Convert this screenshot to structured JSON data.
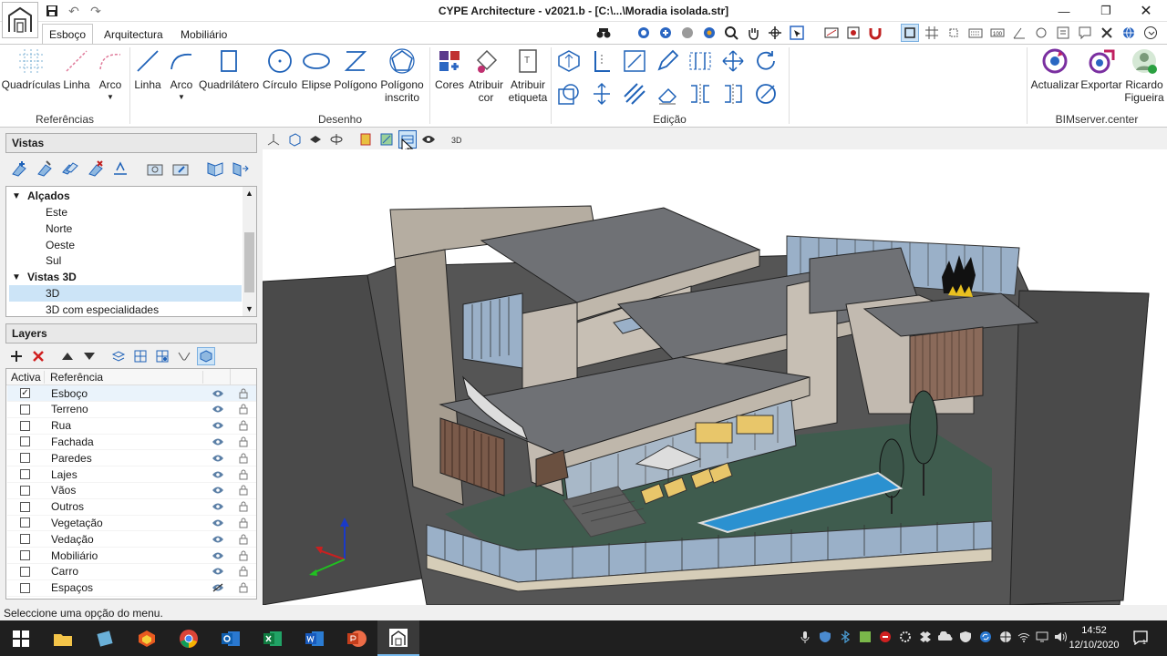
{
  "window": {
    "title": "CYPE Architecture - v2021.b - [C:\\...\\Moradia isolada.str]"
  },
  "tabs": [
    "Esboço",
    "Arquitectura",
    "Mobiliário"
  ],
  "ribbon": {
    "referencias": {
      "label": "Referências",
      "buttons": [
        "Quadrículas",
        "Linha",
        "Arco"
      ]
    },
    "desenho": {
      "label": "Desenho",
      "buttons": [
        "Linha",
        "Arco",
        "Quadrilátero",
        "Círculo",
        "Elipse",
        "Polígono",
        "Polígono\ninscrito",
        "Cores",
        "Atribuir\ncor",
        "Atribuir\netiqueta"
      ]
    },
    "edicao": {
      "label": "Edição"
    },
    "bimserver": {
      "label": "BIMserver.center",
      "buttons": [
        "Actualizar",
        "Exportar",
        "Ricardo\nFigueira"
      ]
    }
  },
  "vistas": {
    "title": "Vistas",
    "tree": [
      {
        "label": "Alçados",
        "type": "group"
      },
      {
        "label": "Este",
        "type": "item"
      },
      {
        "label": "Norte",
        "type": "item"
      },
      {
        "label": "Oeste",
        "type": "item"
      },
      {
        "label": "Sul",
        "type": "item"
      },
      {
        "label": "Vistas 3D",
        "type": "group"
      },
      {
        "label": "3D",
        "type": "item",
        "selected": true
      },
      {
        "label": "3D com especialidades",
        "type": "item"
      }
    ]
  },
  "layers": {
    "title": "Layers",
    "col_active": "Activa",
    "col_ref": "Referência",
    "rows": [
      {
        "name": "Esboço",
        "active": true,
        "visible": true
      },
      {
        "name": "Terreno",
        "active": false,
        "visible": true
      },
      {
        "name": "Rua",
        "active": false,
        "visible": true
      },
      {
        "name": "Fachada",
        "active": false,
        "visible": true
      },
      {
        "name": "Paredes",
        "active": false,
        "visible": true
      },
      {
        "name": "Lajes",
        "active": false,
        "visible": true
      },
      {
        "name": "Vãos",
        "active": false,
        "visible": true
      },
      {
        "name": "Outros",
        "active": false,
        "visible": true
      },
      {
        "name": "Vegetação",
        "active": false,
        "visible": true
      },
      {
        "name": "Vedação",
        "active": false,
        "visible": true
      },
      {
        "name": "Mobiliário",
        "active": false,
        "visible": true
      },
      {
        "name": "Carro",
        "active": false,
        "visible": true
      },
      {
        "name": "Espaços",
        "active": false,
        "visible": false
      }
    ]
  },
  "status": "Seleccione uma opção do menu.",
  "clock": {
    "time": "14:52",
    "date": "12/10/2020"
  },
  "colors": {
    "accent": "#1f62b8",
    "selected": "#cce4f7",
    "taskbar": "#1f1f1f"
  }
}
